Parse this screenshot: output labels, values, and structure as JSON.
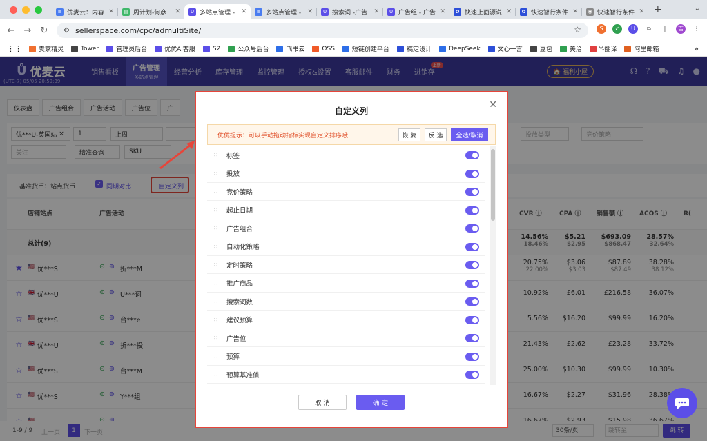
{
  "browser": {
    "tabs": [
      {
        "label": "优麦云：内容",
        "color": "#4a7cf0",
        "glyph": "≡"
      },
      {
        "label": "周计划-何彦",
        "color": "#3fb86a",
        "glyph": "▤"
      },
      {
        "label": "多站点管理 -",
        "color": "#5b4ee8",
        "glyph": "U",
        "active": true
      },
      {
        "label": "多站点管理 -",
        "color": "#4a7cf0",
        "glyph": "≡"
      },
      {
        "label": "搜索词 -广告",
        "color": "#5b4ee8",
        "glyph": "U"
      },
      {
        "label": "广告组 - 广告",
        "color": "#5b4ee8",
        "glyph": "U"
      },
      {
        "label": "快速上面源说",
        "color": "#2d4fd8",
        "glyph": "✿"
      },
      {
        "label": "快速智行条件",
        "color": "#2d4fd8",
        "glyph": "✿"
      },
      {
        "label": "快速智行条件",
        "color": "#888888",
        "glyph": "◉"
      }
    ],
    "url": "sellerspace.com/cpc/admultiSite/",
    "bookmarks": [
      "卖家精灵",
      "Tower",
      "管理员后台",
      "优优AI客服",
      "S2",
      "公众号后台",
      "飞书云",
      "OSS",
      "短链创建平台",
      "稿定设计",
      "DeepSeek",
      "文心一言",
      "豆包",
      "美洽",
      "Y-翻译",
      "阿里邮箱"
    ]
  },
  "app": {
    "logo": "优麦云",
    "timezone": "(UTC-7) 05/05 20:59:39",
    "nav": [
      "销售看板",
      "广告管理",
      "经营分析",
      "库存管理",
      "监控管理",
      "授权&设置",
      "客服邮件",
      "财务",
      "进销存"
    ],
    "nav_active_sub": "多站点管理",
    "nav_badge": "上新",
    "welfare": "福利小屋",
    "subtabs": [
      "仪表盘",
      "广告组合",
      "广告活动",
      "广告位",
      "广"
    ],
    "filters": {
      "shop": "优***U-英国站",
      "shop_count": "1",
      "period": "上周",
      "tag": "关注",
      "match": "精准查询",
      "sku": "SKU",
      "campaign_type": "投放类型",
      "bid_strategy": "竞价策略"
    },
    "toolbar": {
      "currency": "基准货币：站点货币",
      "compare": "同期对比",
      "custom_cols": "自定义列"
    },
    "table": {
      "headers": {
        "site": "店铺站点",
        "campaign": "广告活动",
        "cvr": "CVR",
        "cpa": "CPA",
        "sales": "销售额",
        "acos": "ACOS",
        "more": "R("
      },
      "total_label": "总计(9)",
      "rows": [
        {
          "shop": "优***S",
          "flag": "us",
          "camp": "折***M",
          "cvr": "20.75%",
          "cvr2": "22.00%",
          "cpa": "$3.06",
          "cpa2": "$3.03",
          "sales": "$87.89",
          "sales2": "$87.49",
          "acos": "38.28%",
          "acos2": "38.12%",
          "star": true
        },
        {
          "shop": "优***U",
          "flag": "uk",
          "camp": "U***词",
          "cvr": "10.92%",
          "cpa": "£6.01",
          "sales": "£216.58",
          "acos": "36.07%"
        },
        {
          "shop": "优***S",
          "flag": "us",
          "camp": "台***e",
          "cvr": "5.56%",
          "cpa": "$16.20",
          "sales": "$99.99",
          "acos": "16.20%"
        },
        {
          "shop": "优***U",
          "flag": "uk",
          "camp": "折***投",
          "cvr": "21.43%",
          "cpa": "£2.62",
          "sales": "£23.28",
          "acos": "33.72%"
        },
        {
          "shop": "优***S",
          "flag": "us",
          "camp": "台***M",
          "cvr": "25.00%",
          "cpa": "$10.30",
          "sales": "$99.99",
          "acos": "10.30%"
        },
        {
          "shop": "优***S",
          "flag": "us",
          "camp": "Y***组",
          "cvr": "16.67%",
          "cpa": "$2.27",
          "sales": "$31.96",
          "acos": "28.38%"
        },
        {
          "shop": "",
          "flag": "us",
          "camp": "",
          "cvr": "16.67%",
          "cpa": "$2.93",
          "sales": "$15.98",
          "acos": "36.67%"
        }
      ],
      "total": {
        "cvr": "14.56%",
        "cvr2": "18.46%",
        "cpa": "$5.21",
        "cpa2": "$2.95",
        "sales": "$693.09",
        "sales2": "$868.47",
        "acos": "28.57%",
        "acos2": "32.64%"
      }
    },
    "pager": {
      "range": "1-9 / 9",
      "prev": "上一页",
      "page": "1",
      "next": "下一页",
      "size": "30条/页",
      "jump_label": "跳转至",
      "jump_btn": "跳 转"
    }
  },
  "modal": {
    "title": "自定义列",
    "tip": "优优提示：可以手动拖动指标实现自定义排序哦",
    "restore": "恢 复",
    "invert": "反 选",
    "select_all": "全选/取消",
    "columns": [
      "标签",
      "投放",
      "竞价策略",
      "起止日期",
      "广告组合",
      "自动化策略",
      "定时策略",
      "推广商品",
      "搜索词数",
      "建议预算",
      "广告位",
      "预算",
      "预算基准值"
    ],
    "cancel": "取 消",
    "confirm": "确 定"
  },
  "colors": {
    "accent": "#6a5cf0",
    "nav_bg": "#3d3a9e",
    "highlight": "#e6453a"
  }
}
